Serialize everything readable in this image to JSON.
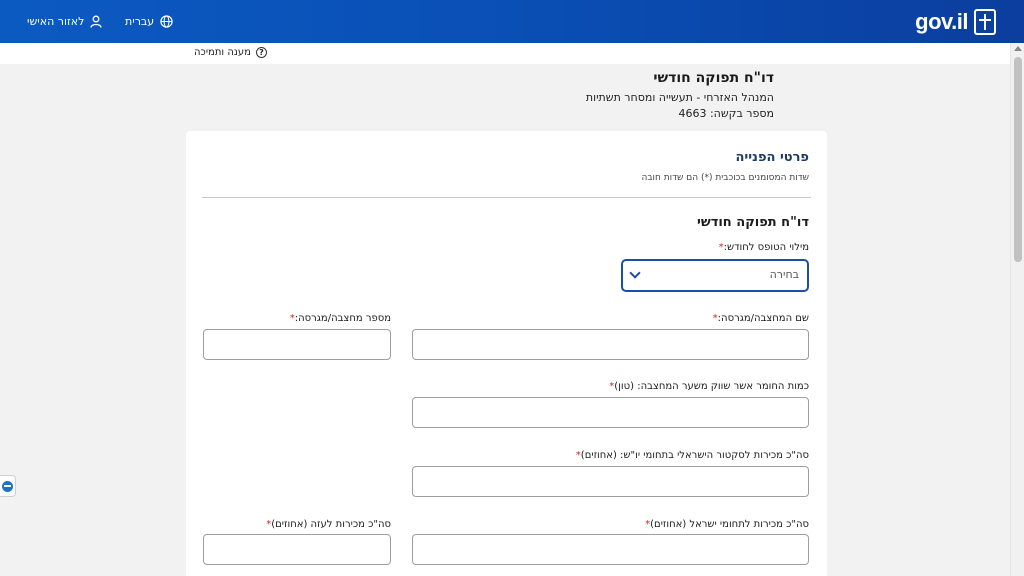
{
  "header": {
    "logo_text": "gov.il",
    "language_label": "עברית",
    "personal_area_label": "לאזור האישי"
  },
  "help": {
    "label": "מענה ותמיכה"
  },
  "request": {
    "title": "דו\"ח תפוקה חודשי",
    "department": "המנהל האזרחי - תעשייה ומסחר תשתיות",
    "request_number": "מספר בקשה: 4663"
  },
  "section": {
    "title": "פרטי הפנייה",
    "required_note": "שדות המסומנים בכוכבית (*) הם שדות חובה"
  },
  "form": {
    "title": "דו\"ח תפוקה חודשי",
    "month_label": "מילוי הטופס לחודש:",
    "month_value": "בחירה",
    "quarry_name_label": "שם המחצבה/מגרסה:",
    "quarry_number_label": "מספר מחצבה/מגרסה:",
    "material_quantity_label": "כמות החומר אשר שווק משער המחצבה: (טון)",
    "sales_yosh_label": "סה\"כ מכירות לסקטור הישראלי בתחומי יו\"ש: (אחוזים)",
    "sales_israel_label": "סה\"כ מכירות לתחומי ישראל (אחוזים)",
    "sales_gaza_label": "סה\"כ מכירות לעזה (אחוזים)",
    "required_mark": "*"
  }
}
